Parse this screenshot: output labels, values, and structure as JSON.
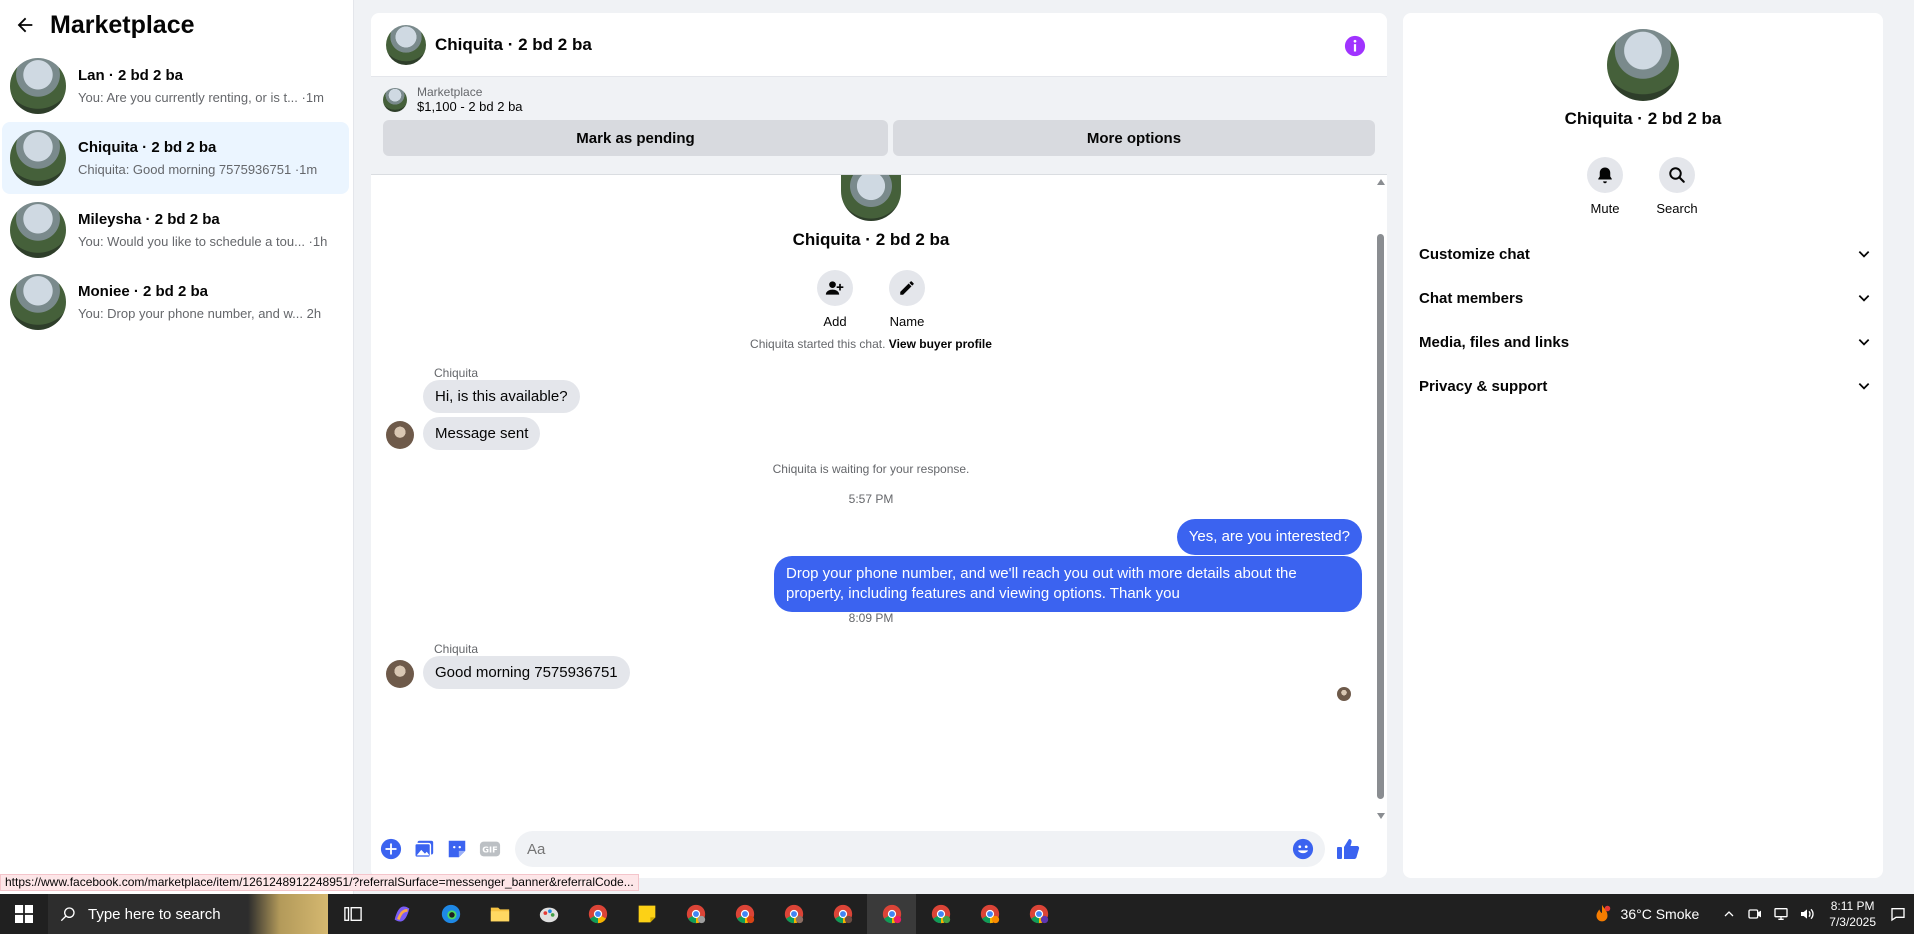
{
  "sidebar": {
    "title": "Marketplace",
    "conversations": [
      {
        "name": "Lan · 2 bd 2 ba",
        "preview": "You: Are you currently renting, or is t... ·1m",
        "active": false
      },
      {
        "name": "Chiquita · 2 bd 2 ba",
        "preview": "Chiquita: Good morning 7575936751 ·1m",
        "active": true
      },
      {
        "name": "Mileysha · 2 bd 2 ba",
        "preview": "You: Would you like to schedule a tou... ·1h",
        "active": false
      },
      {
        "name": "Moniee · 2 bd 2 ba",
        "preview": "You: Drop your phone number, and w... 2h",
        "active": false
      }
    ]
  },
  "chat": {
    "title": "Chiquita · 2 bd 2 ba",
    "banner": {
      "source": "Marketplace",
      "listing": "$1,100 - 2 bd 2 ba",
      "pending_label": "Mark as pending",
      "more_label": "More options"
    },
    "intro": {
      "name": "Chiquita · 2 bd 2 ba",
      "add_label": "Add",
      "name_label": "Name",
      "started": "Chiquita started this chat.",
      "view_profile": "View buyer profile"
    },
    "messages": {
      "sender1": "Chiquita",
      "in1": "Hi, is this available?",
      "in2": "Message sent",
      "waiting": "Chiquita is waiting for your response.",
      "time1": "5:57 PM",
      "out1": "Yes, are you interested?",
      "out2": "Drop your phone number, and we'll reach you out with more details about the property, including features and viewing options.  Thank you",
      "time2": "8:09 PM",
      "sender2": "Chiquita",
      "in3": "Good morning 7575936751"
    },
    "composer": {
      "placeholder": "Aa"
    }
  },
  "panel": {
    "name": "Chiquita · 2 bd 2 ba",
    "mute_label": "Mute",
    "search_label": "Search",
    "sections": [
      "Customize chat",
      "Chat members",
      "Media, files and links",
      "Privacy & support"
    ]
  },
  "status_url": "https://www.facebook.com/marketplace/item/1261248912248951/?referralSurface=messenger_banner&referralCode...",
  "taskbar": {
    "search_placeholder": "Type here to search",
    "weather": "36°C  Smoke",
    "time": "8:11 PM",
    "date": "7/3/2025"
  },
  "colors": {
    "accent": "#3b63f0",
    "info": "#a033ff",
    "active_row": "#ebf5ff"
  }
}
